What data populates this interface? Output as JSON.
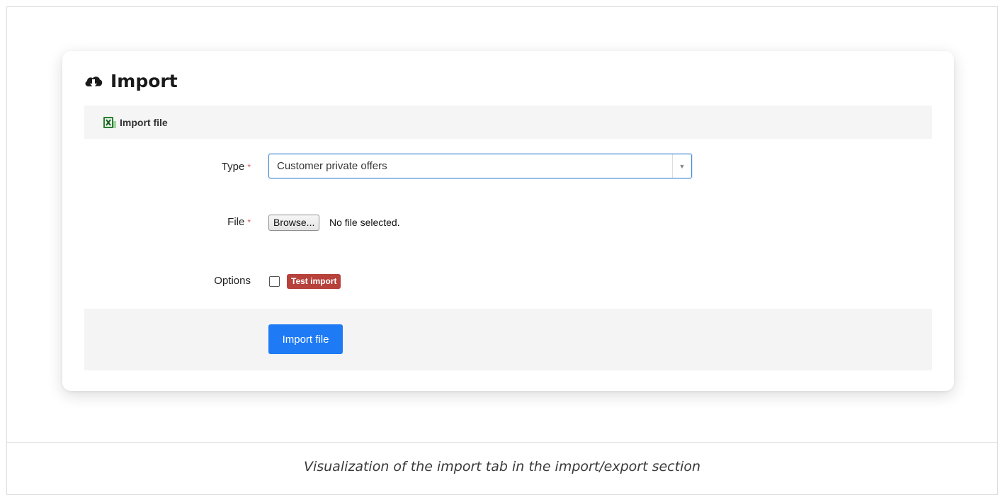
{
  "card": {
    "title": "Import",
    "title_icon": "cloud-download-icon"
  },
  "section": {
    "icon": "excel-file-icon",
    "label": "Import file"
  },
  "form": {
    "type": {
      "label": "Type",
      "required_mark": "*",
      "selected": "Customer private offers"
    },
    "file": {
      "label": "File",
      "required_mark": "*",
      "browse_label": "Browse...",
      "status": "No file selected."
    },
    "options": {
      "label": "Options",
      "checked": false,
      "badge": "Test import",
      "badge_color": "#b7413b"
    }
  },
  "actions": {
    "submit_label": "Import file",
    "submit_color": "#1e7bf5"
  },
  "caption": "Visualization of the import tab in the import/export section"
}
